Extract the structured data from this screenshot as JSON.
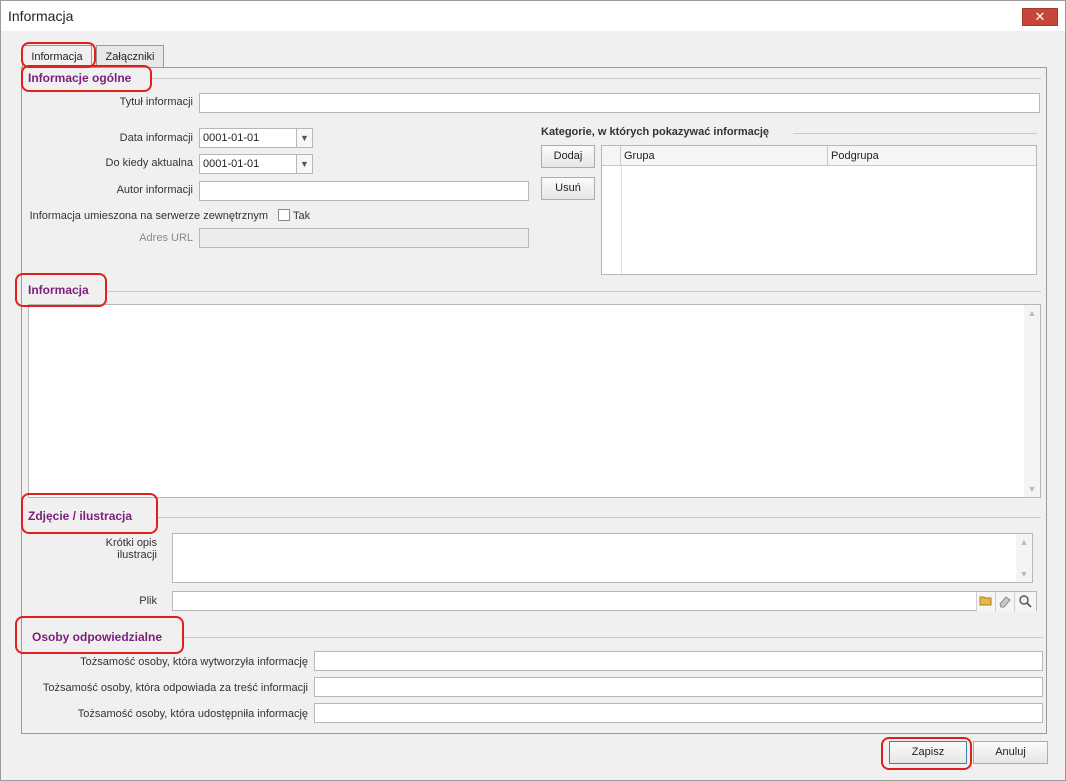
{
  "window": {
    "title": "Informacja",
    "close_glyph": "✕"
  },
  "tabs": [
    {
      "label": "Informacja"
    },
    {
      "label": "Załączniki"
    }
  ],
  "general": {
    "section_title": "Informacje ogólne",
    "title_label": "Tytuł informacji",
    "title_value": "",
    "date_label": "Data informacji",
    "date_value": "0001-01-01",
    "until_label": "Do kiedy aktualna",
    "until_value": "0001-01-01",
    "author_label": "Autor informacji",
    "author_value": "",
    "external_label": "Informacja umieszona na serwerze zewnętrznym",
    "external_checkbox_label": "Tak",
    "url_label": "Adres URL",
    "url_value": ""
  },
  "categories": {
    "title": "Kategorie, w których pokazywać informację",
    "add_label": "Dodaj",
    "remove_label": "Usuń",
    "columns": [
      "Grupa",
      "Podgrupa"
    ],
    "rows": []
  },
  "info": {
    "section_title": "Informacja",
    "content": ""
  },
  "photo": {
    "section_title": "Zdjęcie / ilustracja",
    "desc_label_line1": "Krótki opis",
    "desc_label_line2": "ilustracji",
    "file_label": "Plik",
    "file_value": ""
  },
  "persons": {
    "section_title": "Osoby odpowiedzialne",
    "creator_label": "Tożsamość osoby, która wytworzyła informację",
    "responsible_label": "Tożsamość osoby, która odpowiada za treść informacji",
    "publisher_label": "Tożsamość osoby, która udostępniła informację"
  },
  "footer": {
    "save_label": "Zapisz",
    "cancel_label": "Anuluj"
  },
  "colors": {
    "section_title": "#7b1f7b",
    "highlight": "#e0201a",
    "close_button": "#c7453b"
  }
}
